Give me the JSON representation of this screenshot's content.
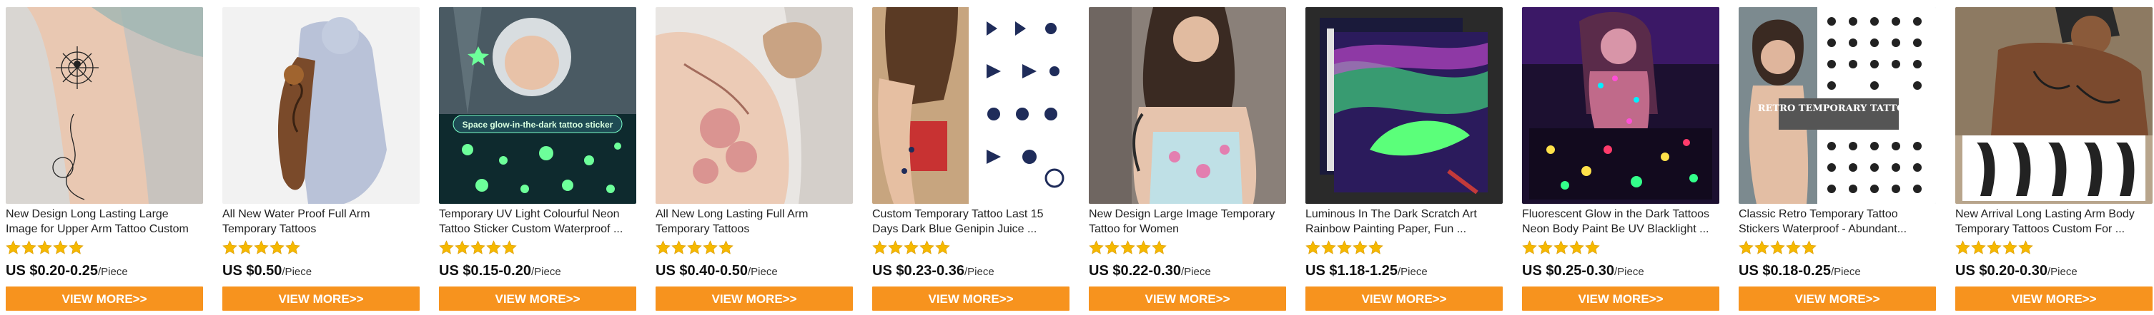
{
  "colors": {
    "accent": "#f7931e",
    "star": "#f5b800",
    "text": "#222222"
  },
  "products": [
    {
      "title": "New Design Long Lasting Large Image for Upper Arm Tattoo Custom",
      "price": "US $0.20-0.25",
      "unit": "/Piece",
      "button": "VIEW MORE>>",
      "rating": 5
    },
    {
      "title": "All New Water Proof Full Arm Temporary Tattoos",
      "price": "US $0.50",
      "unit": "/Piece",
      "button": "VIEW MORE>>",
      "rating": 5
    },
    {
      "title": "Temporary UV Light Colourful Neon Tattoo Sticker Custom Waterproof ...",
      "price": "US $0.15-0.20",
      "unit": "/Piece",
      "button": "VIEW MORE>>",
      "rating": 5,
      "image_text": "Space glow-in-the-dark tattoo sticker"
    },
    {
      "title": "All New Long Lasting Full Arm Temporary Tattoos",
      "price": "US $0.40-0.50",
      "unit": "/Piece",
      "button": "VIEW MORE>>",
      "rating": 5
    },
    {
      "title": "Custom Temporary Tattoo Last 15 Days Dark Blue Genipin Juice ...",
      "price": "US $0.23-0.36",
      "unit": "/Piece",
      "button": "VIEW MORE>>",
      "rating": 5
    },
    {
      "title": "New Design Large Image Temporary Tattoo for Women",
      "price": "US $0.22-0.30",
      "unit": "/Piece",
      "button": "VIEW MORE>>",
      "rating": 5
    },
    {
      "title": "Luminous In The Dark Scratch Art Rainbow Painting Paper, Fun ...",
      "price": "US $1.18-1.25",
      "unit": "/Piece",
      "button": "VIEW MORE>>",
      "rating": 5
    },
    {
      "title": "Fluorescent Glow in the Dark Tattoos Neon Body Paint Be UV Blacklight ...",
      "price": "US $0.25-0.30",
      "unit": "/Piece",
      "button": "VIEW MORE>>",
      "rating": 5
    },
    {
      "title": "Classic Retro Temporary Tattoo Stickers  Waterproof - Abundant...",
      "price": "US $0.18-0.25",
      "unit": "/Piece",
      "button": "VIEW MORE>>",
      "rating": 5,
      "image_text": "RETRO TEMPORARY TATTOOS"
    },
    {
      "title": "New Arrival Long Lasting Arm Body Temporary Tattoos Custom For ...",
      "price": "US $0.20-0.30",
      "unit": "/Piece",
      "button": "VIEW MORE>>",
      "rating": 5
    }
  ]
}
